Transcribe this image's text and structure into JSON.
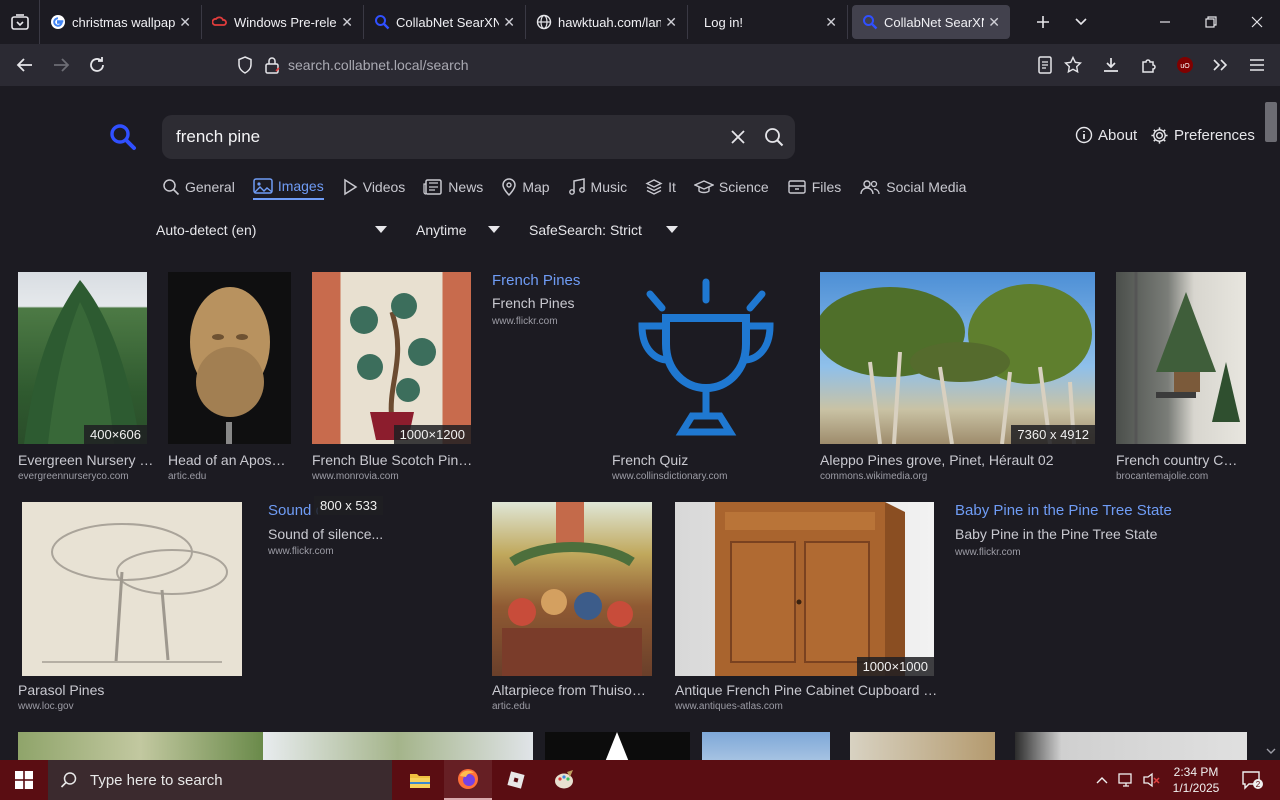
{
  "browser": {
    "tabs": [
      {
        "title": "christmas wallpaper",
        "active": false
      },
      {
        "title": "Windows Pre-release",
        "active": false
      },
      {
        "title": "CollabNet SearXNG",
        "active": false
      },
      {
        "title": "hawktuah.com/landing",
        "active": false
      },
      {
        "title": "Log in!",
        "active": false
      },
      {
        "title": "CollabNet SearXNG",
        "active": true
      }
    ],
    "url": "search.collabnet.local/search"
  },
  "search": {
    "query": "french pine",
    "links": {
      "about": "About",
      "preferences": "Preferences"
    },
    "categories": [
      {
        "label": "General",
        "icon": "magnifier-icon"
      },
      {
        "label": "Images",
        "icon": "image-icon",
        "active": true
      },
      {
        "label": "Videos",
        "icon": "play-icon"
      },
      {
        "label": "News",
        "icon": "newspaper-icon"
      },
      {
        "label": "Map",
        "icon": "map-pin-icon"
      },
      {
        "label": "Music",
        "icon": "music-icon"
      },
      {
        "label": "It",
        "icon": "layers-icon"
      },
      {
        "label": "Science",
        "icon": "graduation-icon"
      },
      {
        "label": "Files",
        "icon": "drawer-icon"
      },
      {
        "label": "Social Media",
        "icon": "people-icon"
      }
    ],
    "filters": {
      "language": "Auto-detect (en)",
      "time": "Anytime",
      "safesearch": "SafeSearch: Strict"
    }
  },
  "results": [
    {
      "title": "Evergreen Nursery C...",
      "source": "evergreennurseryco.com",
      "size": "400×606"
    },
    {
      "title": "Head of an Apostl...",
      "source": "artic.edu",
      "size": ""
    },
    {
      "title": "French Blue Scotch Pine,...",
      "source": "www.monrovia.com",
      "size": "1000×1200"
    },
    {
      "title": "French Pines",
      "subtitle": "French Pines",
      "source": "www.flickr.com",
      "size": ""
    },
    {
      "title": "French Quiz",
      "source": "www.collinsdictionary.com",
      "size": ""
    },
    {
      "title": "Aleppo Pines grove, Pinet, Hérault 02",
      "source": "commons.wikimedia.org",
      "size": "7360 x 4912"
    },
    {
      "title": "French country Chri...",
      "source": "brocantemajolie.com",
      "size": ""
    },
    {
      "title": "Parasol Pines",
      "source": "www.loc.gov",
      "size": ""
    },
    {
      "title": "Sound of silence...",
      "subtitle": "Sound of silence...",
      "source": "www.flickr.com",
      "size": "800 x 533"
    },
    {
      "title": "Altarpiece from Thuison-l...",
      "source": "artic.edu",
      "size": ""
    },
    {
      "title": "Antique French Pine Cabinet Cupboard - A...",
      "source": "www.antiques-atlas.com",
      "size": "1000×1000"
    },
    {
      "title": "Baby Pine in the Pine Tree State",
      "subtitle": "Baby Pine in the Pine Tree State",
      "source": "www.flickr.com",
      "size": ""
    }
  ],
  "taskbar": {
    "search_placeholder": "Type here to search",
    "time": "2:34 PM",
    "date": "1/1/2025",
    "notifications": "2"
  }
}
